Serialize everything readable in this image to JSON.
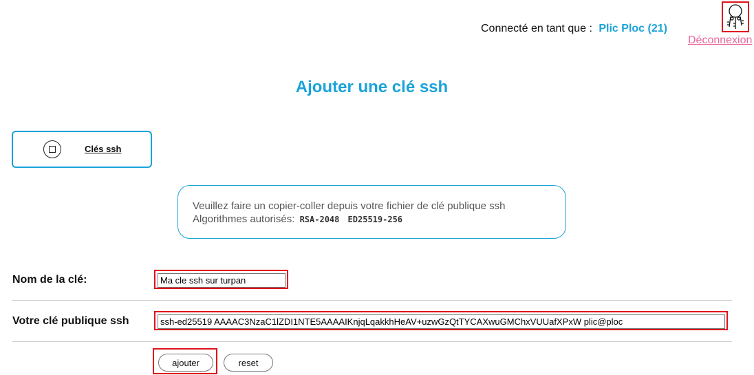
{
  "header": {
    "connected_label": "Connecté en tant que :",
    "user_name": "Plic Ploc (21)",
    "logout_label": "Déconnexion",
    "keys_icon": "keys-icon"
  },
  "page": {
    "title": "Ajouter une clé ssh"
  },
  "nav": {
    "icon": "square-circle-icon",
    "link_label": "Clés ssh"
  },
  "info": {
    "line1": "Veuillez faire un copier-coller depuis votre fichier de clé publique ssh",
    "line2_prefix": "Algorithmes autorisés:",
    "algorithms": [
      "RSA-2048",
      "ED25519-256"
    ]
  },
  "form": {
    "name_label": "Nom de la clé:",
    "name_value": "Ma cle ssh sur turpan",
    "key_label": "Votre clé publique ssh",
    "key_value": "ssh-ed25519 AAAAC3NzaC1lZDI1NTE5AAAAIKnjqLqakkhHeAV+uzwGzQtTYCAXwuGMChxVUUafXPxW plic@ploc",
    "submit_label": "ajouter",
    "reset_label": "reset"
  },
  "colors": {
    "accent": "#1aa3d9",
    "highlight": "#e0111b",
    "logout": "#e8679a"
  }
}
